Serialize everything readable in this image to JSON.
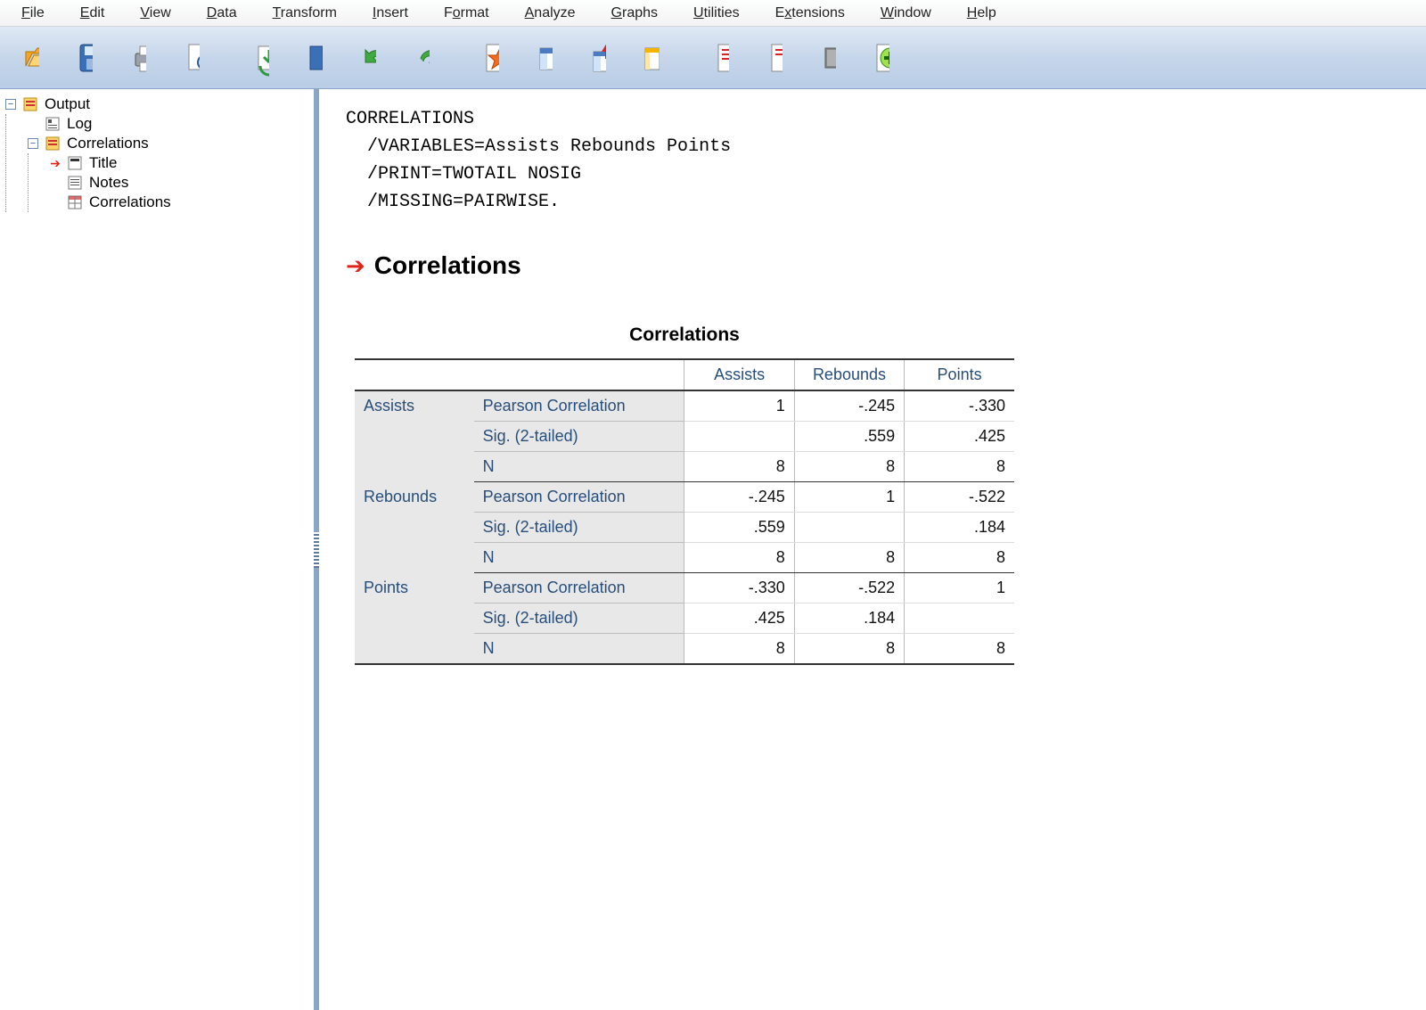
{
  "menubar": [
    "File",
    "Edit",
    "View",
    "Data",
    "Transform",
    "Insert",
    "Format",
    "Analyze",
    "Graphs",
    "Utilities",
    "Extensions",
    "Window",
    "Help"
  ],
  "menubar_ul_index": [
    0,
    0,
    0,
    0,
    0,
    0,
    1,
    0,
    0,
    0,
    1,
    0,
    0
  ],
  "toolbar_icons": [
    "open-icon",
    "save-icon",
    "print-icon",
    "preview-icon",
    "export-icon",
    "goto-case-icon",
    "undo-icon",
    "redo-icon",
    "star-icon",
    "select-variables-icon",
    "insert-cases-icon",
    "split-file-icon",
    "edit-options-icon",
    "run-icon",
    "designate-window-icon",
    "add-icon"
  ],
  "tree": {
    "root": {
      "label": "Output"
    },
    "log": {
      "label": "Log"
    },
    "corr_node": {
      "label": "Correlations"
    },
    "title": {
      "label": "Title"
    },
    "notes": {
      "label": "Notes"
    },
    "corr_leaf": {
      "label": "Correlations"
    }
  },
  "syntax_lines": [
    "CORRELATIONS",
    "  /VARIABLES=Assists Rebounds Points",
    "  /PRINT=TWOTAIL NOSIG",
    "  /MISSING=PAIRWISE."
  ],
  "section_title": "Correlations",
  "table": {
    "title": "Correlations",
    "col_headers": [
      "Assists",
      "Rebounds",
      "Points"
    ],
    "row_vars": [
      "Assists",
      "Rebounds",
      "Points"
    ],
    "stats": [
      "Pearson Correlation",
      "Sig. (2-tailed)",
      "N"
    ],
    "cells": {
      "Assists": {
        "Pearson Correlation": [
          "1",
          "-.245",
          "-.330"
        ],
        "Sig. (2-tailed)": [
          "",
          ".559",
          ".425"
        ],
        "N": [
          "8",
          "8",
          "8"
        ]
      },
      "Rebounds": {
        "Pearson Correlation": [
          "-.245",
          "1",
          "-.522"
        ],
        "Sig. (2-tailed)": [
          ".559",
          "",
          ".184"
        ],
        "N": [
          "8",
          "8",
          "8"
        ]
      },
      "Points": {
        "Pearson Correlation": [
          "-.330",
          "-.522",
          "1"
        ],
        "Sig. (2-tailed)": [
          ".425",
          ".184",
          ""
        ],
        "N": [
          "8",
          "8",
          "8"
        ]
      }
    }
  }
}
